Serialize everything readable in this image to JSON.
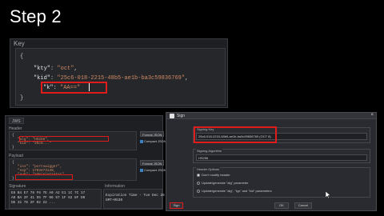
{
  "slide": {
    "title": "Step 2"
  },
  "key_panel": {
    "label": "Key",
    "lines": {
      "open": "{",
      "kty_key": "\"kty\"",
      "kty_val": "\"oct\"",
      "kid_key": "\"kid\"",
      "kid_val": "\"25c6-018-2215-48b5-ae1b-ba3c59836769\"",
      "k_key": "\"k\"",
      "k_val": "\"AA==\"",
      "close": "}"
    }
  },
  "jws_window": {
    "tab": "JWS",
    "header": {
      "label": "Header",
      "lines": [
        "{",
        "\"alg\": \"HS256\",",
        "\"kid\": \"25c6...\"",
        "}"
      ],
      "format_btn": "Format JSON",
      "compact_chk": "Compact JSON"
    },
    "payload": {
      "label": "Payload",
      "lines": [
        "{",
        "\"iss\": \"portswigger\",",
        "\"exp\": 1703473148,",
        "\"sub\": \"administrator\"",
        "}"
      ],
      "format_btn": "Format JSON",
      "compact_chk": "Compact JSON"
    },
    "signature": {
      "label": "Signature",
      "hex_lines": [
        "E8 B4 E7 78 F6 7E A9 A2 E1 1C 7C 17",
        "A0 BA 3F 41 55 7F 96 57 1F 62 8F D0",
        "DE 31 7E 2F 02 22 ..."
      ]
    },
    "information": {
      "label": "Information",
      "lines": [
        "Expiration Time - Tue Dec 26 2023 23:59:08",
        "GMT+0530"
      ]
    }
  },
  "sign_dialog": {
    "title": "Sign",
    "close_icon": "×",
    "signing_key": {
      "group_label": "Signing Key",
      "value": "25c6-018-2215-48b5-ae1b-ba3c59836769 (OCT 8)"
    },
    "signing_algorithm": {
      "group_label": "Signing Algorithm",
      "value": "HS256"
    },
    "header_options": {
      "group_label": "Header Options",
      "options": [
        {
          "label": "Don't modify header",
          "selected": true
        },
        {
          "label": "Update/generate \"alg\" parameter",
          "selected": false
        },
        {
          "label": "Update/generate \"alg\", \"typ\" and \"kid\" parameters",
          "selected": false
        }
      ]
    },
    "buttons": {
      "sign": "Sign",
      "ok": "OK",
      "cancel": "Cancel"
    }
  },
  "colors": {
    "highlight": "#e01b1b",
    "string": "#d08a63",
    "panel": "#1e1f23"
  }
}
